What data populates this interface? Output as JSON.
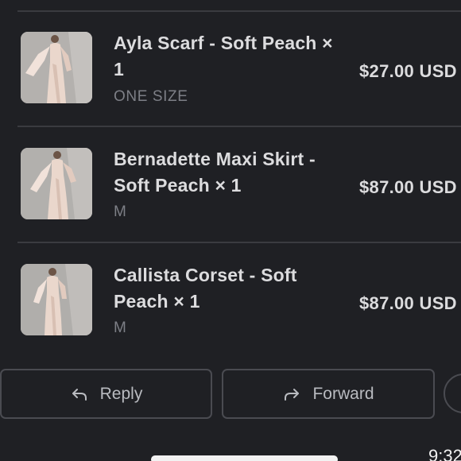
{
  "order_items": [
    {
      "title": "Ayla Scarf - Soft Peach × 1",
      "variant": "ONE SIZE",
      "price": "$27.00 USD",
      "thumbnail": "product-photo-model-in-peach-gown"
    },
    {
      "title": "Bernadette Maxi Skirt - Soft Peach × 1",
      "variant": "M",
      "price": "$87.00 USD",
      "thumbnail": "product-photo-model-in-peach-gown"
    },
    {
      "title": "Callista Corset - Soft Peach × 1",
      "variant": "M",
      "price": "$87.00 USD",
      "thumbnail": "product-photo-model-in-peach-gown"
    }
  ],
  "actions": {
    "reply_label": "Reply",
    "reply_icon": "reply-arrow-icon",
    "forward_label": "Forward",
    "forward_icon": "forward-arrow-icon",
    "more_icon": "more-options-icon"
  },
  "status_bar": {
    "time": "9:32"
  },
  "colors": {
    "background": "#1f2024",
    "text_primary": "#dcdcde",
    "text_secondary": "#7d7f86",
    "divider": "#3a3b40",
    "button_border": "#4a4b51"
  }
}
